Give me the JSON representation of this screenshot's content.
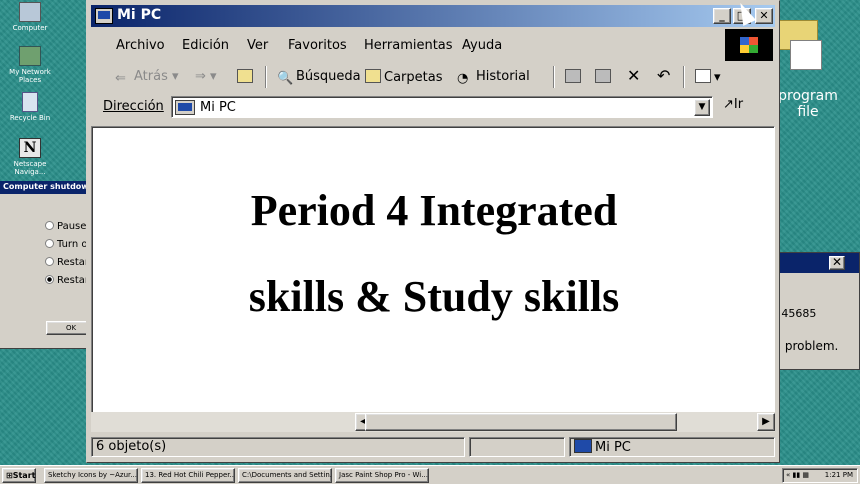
{
  "desktop": {
    "icons": [
      {
        "label": "Computer",
        "icon": "computer-icon"
      },
      {
        "label": "My Network Places",
        "icon": "network-icon"
      },
      {
        "label": "Recycle Bin",
        "icon": "recycle-bin-icon"
      },
      {
        "label": "Netscape Naviga...",
        "icon": "netscape-icon"
      }
    ],
    "program_file_label": "program file"
  },
  "shutdown_dialog": {
    "title": "Computer shutdown",
    "options": [
      "Pause",
      "Turn of",
      "Restar",
      "Restar"
    ],
    "selected_index": 3,
    "ok_label": "OK"
  },
  "right_window": {
    "text1": "!45685",
    "text2": ": problem.",
    "close_glyph": "✕"
  },
  "window": {
    "title": "Mi PC",
    "menu": [
      "Archivo",
      "Edición",
      "Ver",
      "Favoritos",
      "Herramientas",
      "Ayuda"
    ],
    "toolbar": {
      "back": "Atrás",
      "search": "Búsqueda",
      "folders": "Carpetas",
      "history": "Historial"
    },
    "address": {
      "label": "Dirección",
      "value": "Mi PC",
      "go": "Ir"
    },
    "content": {
      "title": "Period 4 Integrated",
      "subtitle": "skills & Study skills"
    },
    "status": {
      "objects": "6 objeto(s)",
      "location": "Mi PC"
    }
  },
  "taskbar": {
    "start": "Start",
    "tasks": [
      "Sketchy Icons by ~Azur...",
      "13. Red Hot Chili Pepper...",
      "C:\\Documents and Settin...",
      "Jasc Paint Shop Pro - Wi..."
    ],
    "clock": "1:21 PM"
  },
  "colors": {
    "desktop": "#2a8f8a",
    "title_active": "#0a246a",
    "chrome": "#d4d0c8"
  }
}
